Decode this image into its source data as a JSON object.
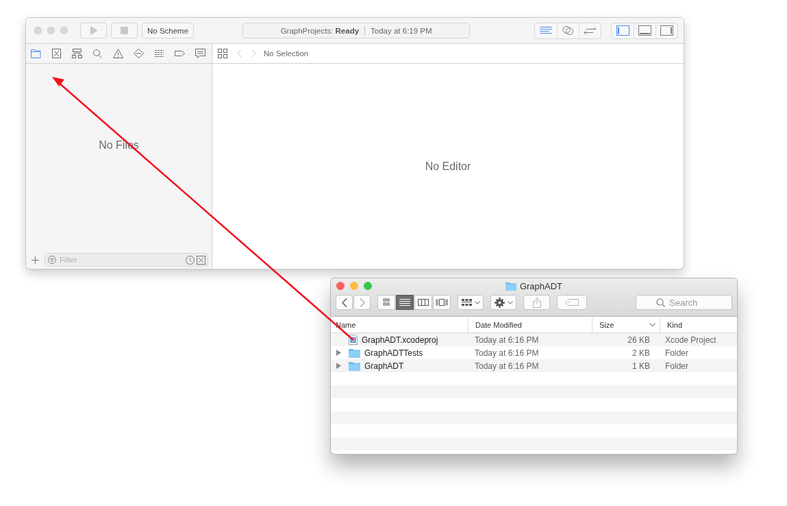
{
  "xcode": {
    "active": false,
    "scheme": "No Scheme",
    "activity": {
      "project": "GraphProjects:",
      "status": "Ready",
      "time": "Today at 6:19 PM"
    },
    "editor_modes": [
      {
        "kind": "standard",
        "selected": true
      },
      {
        "kind": "assistant",
        "selected": false
      },
      {
        "kind": "version",
        "selected": false
      }
    ],
    "panels": [
      {
        "kind": "navigator",
        "selected": true
      },
      {
        "kind": "debug",
        "selected": false
      },
      {
        "kind": "utilities",
        "selected": false
      }
    ],
    "navigator_tabs": [
      {
        "kind": "folder",
        "selected": true
      },
      {
        "kind": "source-control",
        "selected": false
      },
      {
        "kind": "hierarchy",
        "selected": false
      },
      {
        "kind": "search",
        "selected": false
      },
      {
        "kind": "warning",
        "selected": false
      },
      {
        "kind": "diamond",
        "selected": false
      },
      {
        "kind": "list",
        "selected": false
      },
      {
        "kind": "tag",
        "selected": false
      },
      {
        "kind": "comment",
        "selected": false
      }
    ],
    "jump_bar": "No Selection",
    "navigator_empty": "No Files",
    "editor_empty": "No Editor",
    "filter": {
      "placeholder": "Filter"
    }
  },
  "finder": {
    "active": true,
    "title": "GraphADT",
    "view_modes": [
      {
        "kind": "icons",
        "selected": false
      },
      {
        "kind": "list",
        "selected": true
      },
      {
        "kind": "columns",
        "selected": false
      },
      {
        "kind": "cover-flow",
        "selected": false
      }
    ],
    "search": {
      "placeholder": "Search"
    },
    "columns": [
      {
        "label": "Name",
        "sorted": false
      },
      {
        "label": "Date Modified",
        "sorted": false
      },
      {
        "label": "Size",
        "sorted": true
      },
      {
        "label": "Kind",
        "sorted": false
      }
    ],
    "rows": [
      {
        "kind": "project",
        "expanded": null,
        "name": "GraphADT.xcodeproj",
        "date": "Today at 6:16 PM",
        "size": "26 KB",
        "kind_label": "Xcode Project"
      },
      {
        "kind": "folder",
        "expanded": false,
        "name": "GraphADTTests",
        "date": "Today at 6:16 PM",
        "size": "2 KB",
        "kind_label": "Folder"
      },
      {
        "kind": "folder",
        "expanded": false,
        "name": "GraphADT",
        "date": "Today at 6:16 PM",
        "size": "1 KB",
        "kind_label": "Folder"
      }
    ]
  }
}
